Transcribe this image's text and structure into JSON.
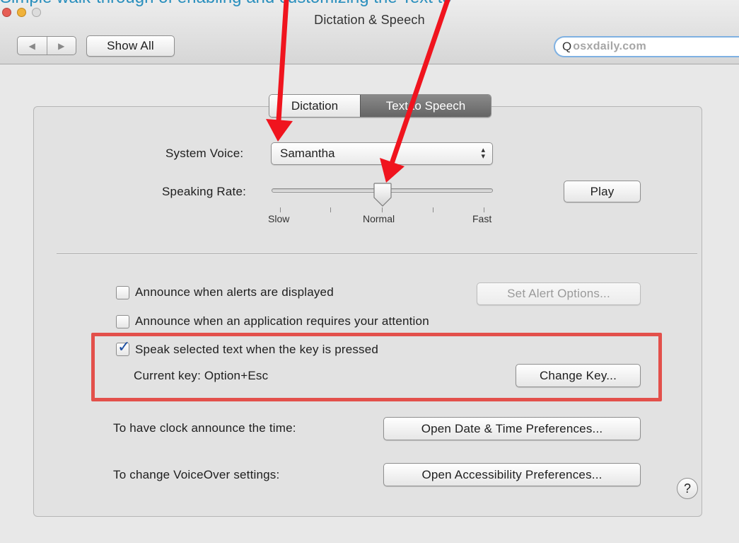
{
  "window": {
    "title": "Dictation & Speech",
    "caption_fragment": "Simple walk-through of enabling and customizing the Text to Speech feature"
  },
  "toolbar": {
    "back_glyph": "◀",
    "forward_glyph": "▶",
    "show_all_label": "Show All",
    "search_placeholder": "osxdaily.com",
    "search_glyph": "Q"
  },
  "tabs": [
    {
      "label": "Dictation",
      "selected": false
    },
    {
      "label": "Text to Speech",
      "selected": true
    }
  ],
  "voice": {
    "label": "System Voice:",
    "value": "Samantha",
    "arrows": "▴▾"
  },
  "rate": {
    "label": "Speaking Rate:",
    "min_label": "Slow",
    "mid_label": "Normal",
    "max_label": "Fast",
    "level": 0.5,
    "play_label": "Play"
  },
  "options": {
    "alerts_label": "Announce when alerts are displayed",
    "alerts_checked": false,
    "alert_options_label": "Set Alert Options...",
    "attention_label": "Announce when an application requires your attention",
    "attention_checked": false,
    "speak_selected_label": "Speak selected text when the key is pressed",
    "speak_selected_checked": true,
    "current_key_label": "Current key: Option+Esc",
    "change_key_label": "Change Key...",
    "check_glyph": "✓"
  },
  "clock": {
    "label": "To have clock announce the time:",
    "button_label": "Open Date & Time Preferences..."
  },
  "voiceover": {
    "label": "To change VoiceOver settings:",
    "button_label": "Open Accessibility Preferences..."
  },
  "help_glyph": "?",
  "colors": {
    "annotation": "#e3504b",
    "arrow": "#f0141e",
    "selected_tab": "#6e6e6e",
    "search_focus": "#7fb1e2"
  }
}
